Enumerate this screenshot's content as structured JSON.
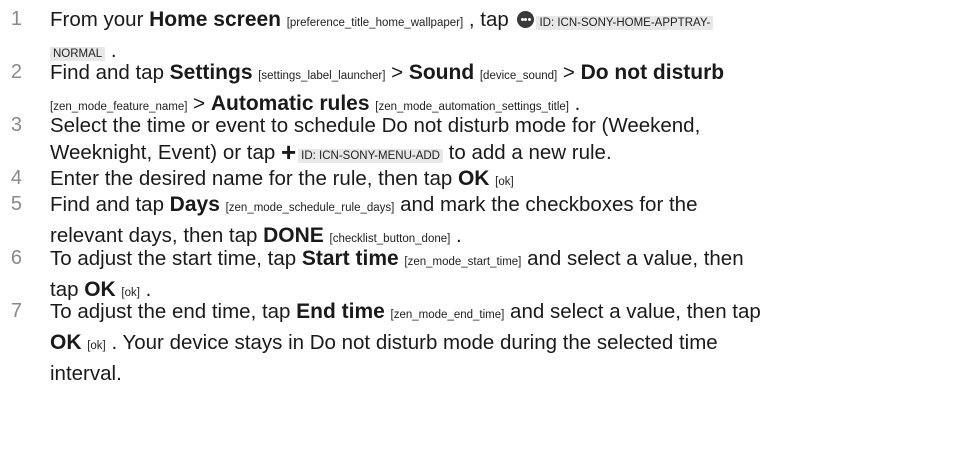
{
  "steps": [
    {
      "num": "1",
      "lines": [
        [
          "From your ",
          {
            "b": "Home screen"
          },
          " ",
          {
            "k": "[preference_title_home_wallpaper]"
          },
          " , tap ",
          {
            "icon": "app-tray-icon"
          },
          {
            "kbg": "ID: ICN-SONY-HOME-APPTRAY-"
          }
        ],
        [
          {
            "kbg": "NORMAL"
          },
          " ."
        ]
      ]
    },
    {
      "num": "2",
      "lines": [
        [
          "Find and tap ",
          {
            "b": "Settings"
          },
          " ",
          {
            "k": "[settings_label_launcher]"
          },
          " > ",
          {
            "b": "Sound"
          },
          " ",
          {
            "k": "[device_sound]"
          },
          " > ",
          {
            "b": "Do not disturb"
          }
        ],
        [
          {
            "k": "[zen_mode_feature_name]"
          },
          " > ",
          {
            "b": "Automatic rules"
          },
          " ",
          {
            "k": "[zen_mode_automation_settings_title]"
          },
          " ."
        ]
      ]
    },
    {
      "num": "3",
      "lines": [
        [
          "Select the time or event to schedule Do not disturb mode for (Weekend,"
        ],
        [
          "Weeknight, Event) or tap ",
          {
            "icon": "add-icon"
          },
          {
            "kbg": "ID: ICN-SONY-MENU-ADD"
          },
          " to add a new rule."
        ]
      ]
    },
    {
      "num": "4",
      "lines": [
        [
          "Enter the desired name for the rule, then tap ",
          {
            "b": "OK"
          },
          " ",
          {
            "k": "[ok]"
          }
        ]
      ]
    },
    {
      "num": "5",
      "lines": [
        [
          "Find and tap ",
          {
            "b": "Days"
          },
          " ",
          {
            "k": "[zen_mode_schedule_rule_days]"
          },
          " and mark the checkboxes for the"
        ],
        [
          "relevant days, then tap ",
          {
            "b": "DONE"
          },
          " ",
          {
            "k": "[checklist_button_done]"
          },
          " ."
        ]
      ]
    },
    {
      "num": "6",
      "lines": [
        [
          "To adjust the start time, tap ",
          {
            "b": "Start time"
          },
          " ",
          {
            "k": "[zen_mode_start_time]"
          },
          " and select a value, then"
        ],
        [
          "tap ",
          {
            "b": "OK"
          },
          " ",
          {
            "k": "[ok]"
          },
          " ."
        ]
      ]
    },
    {
      "num": "7",
      "lines": [
        [
          "To adjust the end time, tap ",
          {
            "b": "End time"
          },
          " ",
          {
            "k": "[zen_mode_end_time]"
          },
          " and select a value, then tap"
        ],
        [
          {
            "b": "OK"
          },
          " ",
          {
            "k": "[ok]"
          },
          " . Your device stays in Do not disturb mode during the selected time"
        ],
        [
          "interval."
        ]
      ]
    }
  ]
}
